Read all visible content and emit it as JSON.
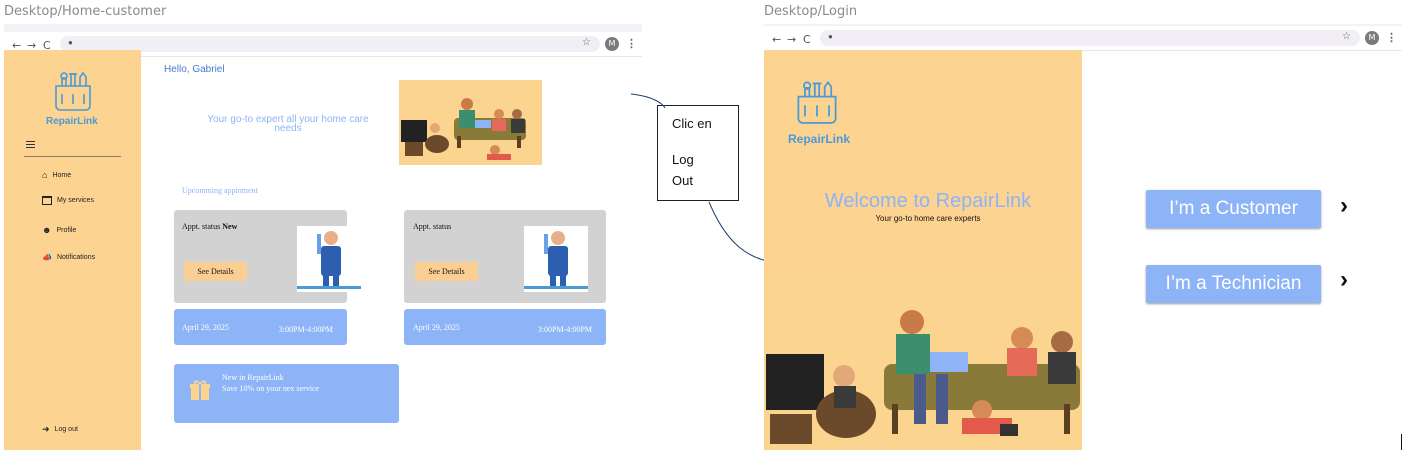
{
  "left_frame": {
    "label": "Desktop/Home-customer",
    "brand": "RepairLink",
    "greeting": "Hello, Gabriel",
    "hero_text": "Your go-to expert all your home care needs",
    "section_title": "Upcomming appinment",
    "menu": [
      {
        "label": "Home",
        "icon": "home-icon"
      },
      {
        "label": "My services",
        "icon": "folder-icon"
      },
      {
        "label": "Profile",
        "icon": "person-icon"
      },
      {
        "label": "Notifications",
        "icon": "megaphone-icon"
      }
    ],
    "logout_label": "Log out",
    "cards": [
      {
        "status_label": "Appt. status",
        "status_value": "New",
        "button": "See Details",
        "date": "April 29, 2025",
        "time": "3:00PM-4:00PM"
      },
      {
        "status_label": "Appt. status",
        "status_value": "",
        "button": "See Details",
        "date": "April 29, 2025",
        "time": "3:00PM-4:00PM"
      }
    ],
    "promo": {
      "line1": "New in RepairLink",
      "line2": "Save 10% on your nex service"
    }
  },
  "annotation": {
    "line1": "Clic en",
    "line2": "Log",
    "line3": "Out"
  },
  "right_frame": {
    "label": "Desktop/Login",
    "brand": "RepairLink",
    "welcome": "Welcome to RepairLink",
    "tagline": "Your go-to home care experts",
    "customer_button": "I’m a Customer",
    "technician_button": "I’m a Technician"
  },
  "browser": {
    "avatar_letter": "M",
    "back": "←",
    "forward": "→",
    "reload": "C"
  },
  "colors": {
    "sidebar": "#fdd392",
    "accent_blue": "#8db4f7",
    "brand_blue": "#4a9ad6",
    "card_grey": "#d2d2d2",
    "button_peach": "#fbcf93"
  }
}
